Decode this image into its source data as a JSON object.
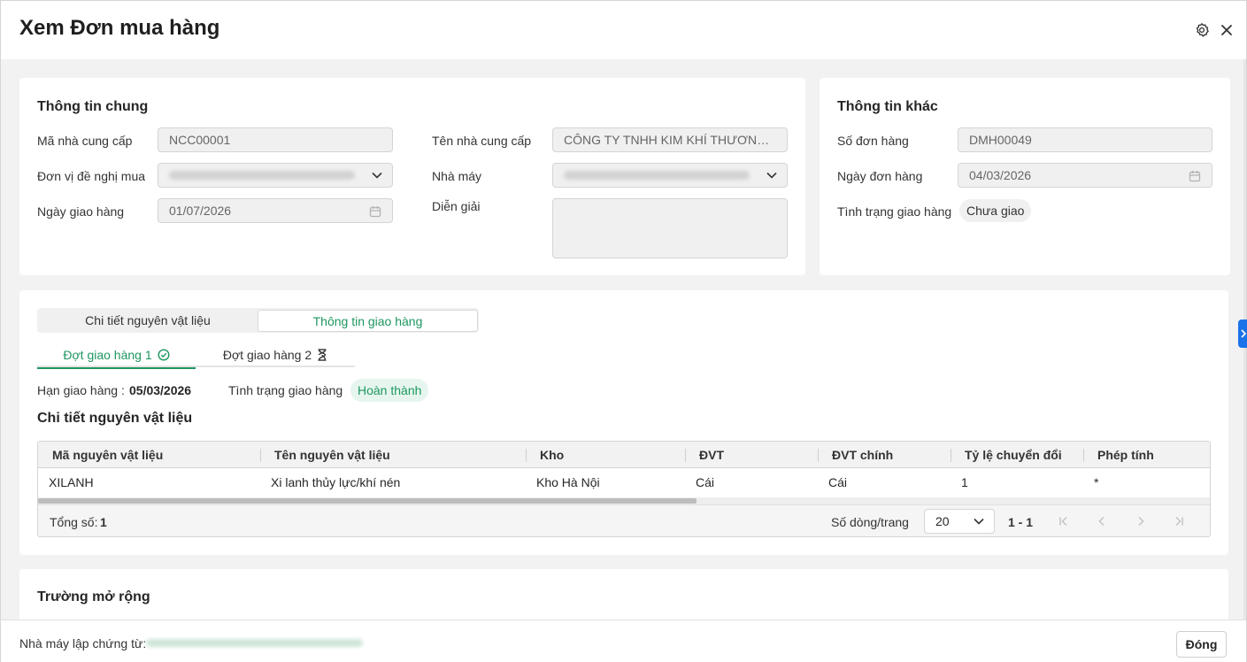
{
  "header": {
    "title": "Xem Đơn mua hàng",
    "settings_icon": "gear-icon",
    "close_icon": "close-icon"
  },
  "general": {
    "title": "Thông tin chung",
    "supplier_code_label": "Mã nhà cung cấp",
    "supplier_code_value": "NCC00001",
    "supplier_name_label": "Tên nhà cung cấp",
    "supplier_name_value": "CÔNG TY TNHH KIM KHÍ THƯƠNG ...",
    "requesting_unit_label": "Đơn vị đề nghị mua",
    "factory_label": "Nhà máy",
    "delivery_date_label": "Ngày giao hàng",
    "delivery_date_value": "01/07/2026",
    "description_label": "Diễn giải"
  },
  "other": {
    "title": "Thông tin khác",
    "order_no_label": "Số đơn hàng",
    "order_no_value": "DMH00049",
    "order_date_label": "Ngày đơn hàng",
    "order_date_value": "04/03/2026",
    "delivery_status_label": "Tình trạng giao hàng",
    "delivery_status_value": "Chưa giao"
  },
  "tabs": {
    "items": [
      "Chi tiết nguyên vật liệu",
      "Thông tin giao hàng"
    ],
    "active_index": 1
  },
  "delivery_batches": {
    "items": [
      {
        "label": "Đợt giao hàng 1",
        "icon": "check-circle-icon"
      },
      {
        "label": "Đợt giao hàng 2",
        "icon": "hourglass-icon"
      }
    ],
    "active_index": 0
  },
  "batch_info": {
    "deadline_label": "Hạn giao hàng :",
    "deadline_value": "05/03/2026",
    "status_label": "Tình trạng giao hàng",
    "status_value": "Hoàn thành"
  },
  "material_detail": {
    "title": "Chi tiết nguyên vật liệu",
    "columns": [
      "Mã nguyên vật liệu",
      "Tên nguyên vật liệu",
      "Kho",
      "ĐVT",
      "ĐVT chính",
      "Tỷ lệ chuyển đổi",
      "Phép tính"
    ],
    "rows": [
      [
        "XILANH",
        "Xi lanh thủy lực/khí nén",
        "Kho Hà Nội",
        "Cái",
        "Cái",
        "1",
        "*"
      ]
    ],
    "total_label": "Tổng số:",
    "total_value": "1",
    "rows_per_page_label": "Số dòng/trang",
    "rows_per_page_value": "20",
    "range": "1 - 1"
  },
  "extension": {
    "title": "Trường mở rộng"
  },
  "footer": {
    "factory_label": "Nhà máy lập chứng từ:",
    "close_button": "Đóng"
  },
  "colors": {
    "accent": "#1e9660",
    "success_bg": "#e6f6ee",
    "neutral_pill_bg": "#f0f0f0",
    "handle": "#1a73e8"
  }
}
